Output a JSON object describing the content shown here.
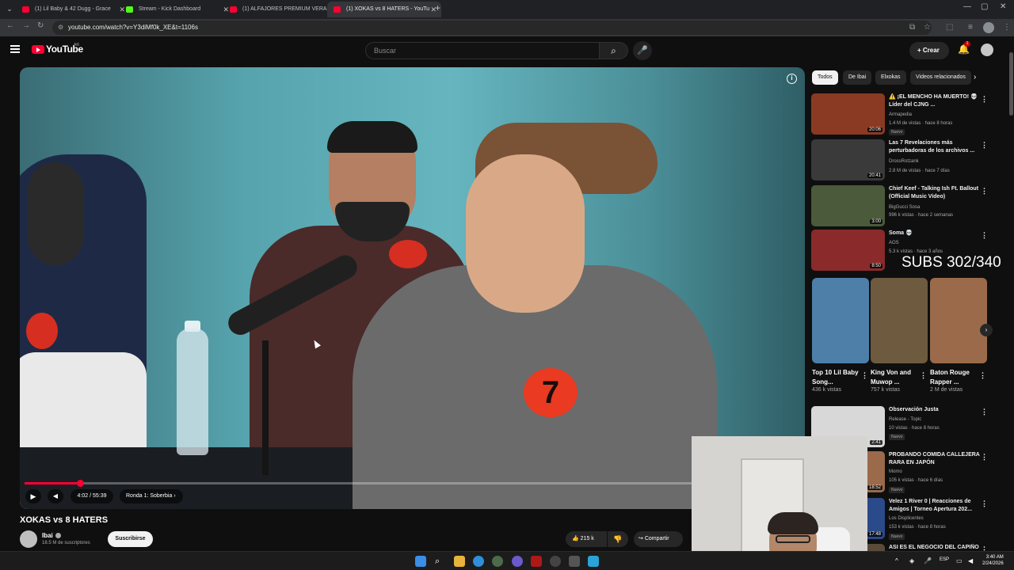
{
  "browser": {
    "tabs": [
      {
        "title": "(1) Lil Baby & 42 Dugg - Grace",
        "favicon": "youtube-favicon",
        "active": false
      },
      {
        "title": "Stream - Kick Dashboard",
        "favicon": "kick-favicon",
        "active": false
      },
      {
        "title": "(1) ALFAJORES PREMIUM VERA",
        "favicon": "youtube-favicon",
        "active": false
      },
      {
        "title": "(1) XOKAS vs 8 HATERS - YouTu",
        "favicon": "youtube-favicon",
        "active": true
      }
    ],
    "url": "youtube.com/watch?v=Y3diMf0k_XE&t=1106s"
  },
  "youtube": {
    "logo_text": "YouTube",
    "country": "AR",
    "search_placeholder": "Buscar",
    "create_label": "Crear",
    "notification_count": "1"
  },
  "player": {
    "current_time": "4:02",
    "total_time": "55:39",
    "time_label": "4:02 / 55:39",
    "chapter_label": "Ronda 1: Soberbia",
    "jersey_number": "7",
    "progress_fraction": 0.0725,
    "chapter_marks": [
      0.0,
      0.04,
      0.075
    ]
  },
  "video": {
    "title": "XOKAS vs 8 HATERS",
    "channel_name": "Ibai",
    "subscribers": "18.5 M de suscriptores",
    "subscribe_label": "Suscribirse",
    "likes": "215 k",
    "share_label": "Compartir"
  },
  "sidebar": {
    "chips": [
      "Todos",
      "De Ibai",
      "Elxokas",
      "Videos relacionados"
    ],
    "recommendations_top": [
      {
        "title": "⚠️ ¡EL MENCHO HA MUERTO! 💀 Líder del CJNG ...",
        "channel": "Armapedia",
        "meta": "1.4 M de vistas · hace 8 horas",
        "badge": "Nuevo",
        "duration": "20:06",
        "color": "#8a3a22"
      },
      {
        "title": "Las 7 Revelaciones más perturbadoras de los archivos ...",
        "channel": "DrossRotzank",
        "meta": "2.8 M de vistas · hace 7 días",
        "badge": "",
        "duration": "20:41",
        "color": "#3a3a3a"
      },
      {
        "title": "Chief Keef - Talking Ish Ft. Ballout (Official Music Video)",
        "channel": "BigGucci Sosa",
        "meta": "996 k vistas · hace 2 semanas",
        "badge": "",
        "duration": "3:00",
        "color": "#4a5a3a"
      },
      {
        "title": "Soma 💀",
        "channel": "AOS",
        "meta": "5.3 k vistas · hace 3 años",
        "badge": "",
        "duration": "8:50",
        "color": "#8a2a2a"
      }
    ],
    "shorts": [
      {
        "title": "Top 10 Lil Baby Song...",
        "views": "436 k vistas",
        "color": "#4d7fa8"
      },
      {
        "title": "King Von and Muwop ...",
        "views": "757 k vistas",
        "color": "#6d5a3f"
      },
      {
        "title": "Baton Rouge Rapper ...",
        "views": "2 M de vistas",
        "color": "#9a6a4a"
      }
    ],
    "recommendations_bottom": [
      {
        "title": "Observación Justa",
        "channel": "Release - Topic",
        "meta": "10 vistas · hace 8 horas",
        "badge": "Nuevo",
        "duration": "2:41",
        "color": "#d8d8d8"
      },
      {
        "title": "PROBANDO COMIDA CALLEJERA RARA EN JAPÓN",
        "channel": "Momo",
        "meta": "105 k vistas · hace 6 días",
        "badge": "Nuevo",
        "duration": "18:52",
        "color": "#9a6a4a"
      },
      {
        "title": "Velez 1 River 0 | Reacciones de Amigos | Torneo Apertura 202...",
        "channel": "Los Displicentes",
        "meta": "153 k vistas · hace 8 horas",
        "badge": "Nuevo",
        "duration": "17:48",
        "color": "#2a4a8a"
      },
      {
        "title": "ASI ES EL NEGOCIO DEL CAPIÑO",
        "channel": "",
        "meta": "",
        "badge": "",
        "duration": "",
        "color": "#5a4a3a"
      }
    ]
  },
  "overlay": {
    "subs_counter": "SUBS 302/340"
  },
  "taskbar": {
    "language": "ESP",
    "time": "3:40 AM",
    "date": "2/24/2026"
  }
}
